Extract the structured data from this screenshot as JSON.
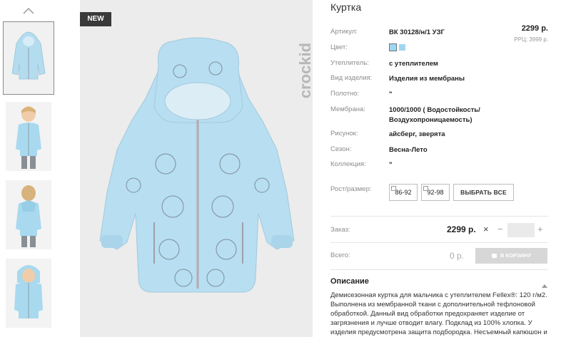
{
  "gallery": {
    "badge": "NEW",
    "brand": "crockid"
  },
  "product": {
    "title": "Куртка",
    "price": "2299 р.",
    "rrc": "РРЦ: 3999 р.",
    "fields": [
      {
        "label": "Артикул:",
        "value": "ВК 30128/н/1 УЗГ"
      },
      {
        "label": "Цвет:",
        "value": ""
      },
      {
        "label": "Утеплитель:",
        "value": "с утеплителем"
      },
      {
        "label": "Вид изделия:",
        "value": "Изделия из мембраны"
      },
      {
        "label": "Полотно:",
        "value": "\""
      },
      {
        "label": "Мембрана:",
        "value": "1000/1000 ( Водостойкость/"
      },
      {
        "label": "",
        "value": "Воздухопроницаемость)"
      },
      {
        "label": "Рисунок:",
        "value": "айсберг, зверята"
      },
      {
        "label": "Сезон:",
        "value": "Весна-Лето"
      },
      {
        "label": "Коллекция:",
        "value": "\""
      }
    ],
    "colors": [
      "#9fd6f2",
      "#9fd6f2"
    ],
    "sizes_label": "Рост/размер:",
    "sizes": [
      "86-92",
      "92-98"
    ],
    "select_all": "ВЫБРАТЬ ВСЕ"
  },
  "order": {
    "label": "Заказ:",
    "price": "2299 р.",
    "times": "×",
    "minus": "−",
    "plus": "+",
    "quantity": "",
    "total_label": "Всего:",
    "total": "0 р.",
    "cart_button": "В КОРЗИНУ"
  },
  "description": {
    "title": "Описание",
    "text": "Демисезонная куртка для мальчика с утеплителем Fellex®: 120 г/м2. Выполнена из мембранной ткани с дополнительной тефлоновой обработкой. Данный вид обработки предохраняет изделие от загрязнения и лучше отводит влагу. Подклад из 100% хлопка. У изделия предусмотрена защита подбородка. Несъемный капюшон и"
  }
}
